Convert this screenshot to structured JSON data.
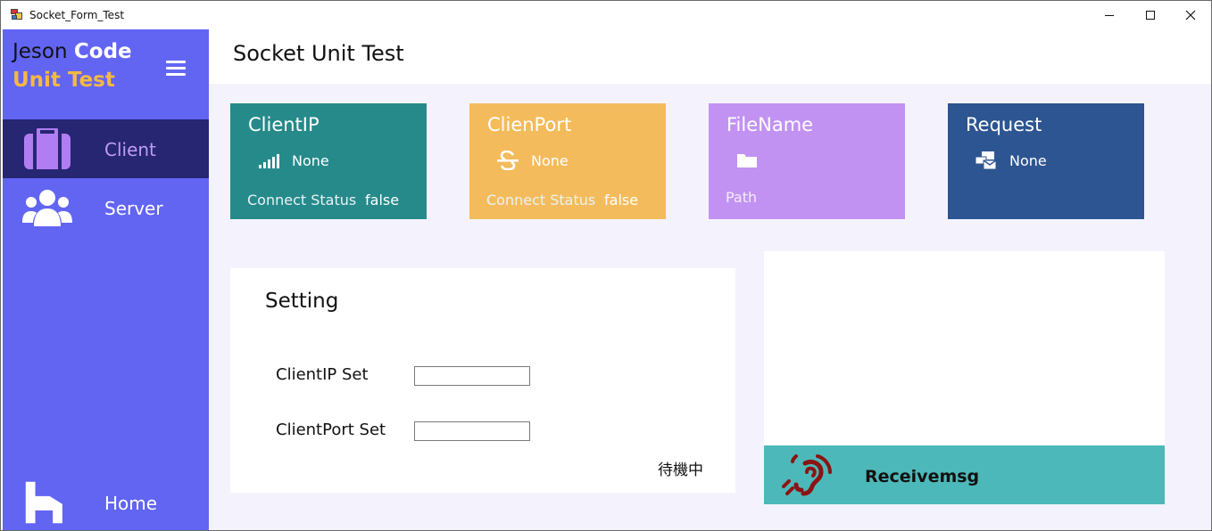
{
  "window": {
    "title": "Socket_Form_Test"
  },
  "sidebar": {
    "brand_part1": "Jeson ",
    "brand_part2": "Code",
    "brand_line2": "Unit Test",
    "items": [
      {
        "label": "Client",
        "icon": "luggage-icon",
        "active": true
      },
      {
        "label": "Server",
        "icon": "users-icon",
        "active": false
      },
      {
        "label": "Home",
        "icon": "home-icon",
        "active": false
      }
    ]
  },
  "header": {
    "title": "Socket Unit Test"
  },
  "cards": [
    {
      "title": "ClientIP",
      "icon": "signal-icon",
      "value": "None",
      "sub_label": "Connect Status",
      "sub_value": "false",
      "color": "#268a8b"
    },
    {
      "title": "ClienPort",
      "icon": "strikethrough-icon",
      "value": "None",
      "sub_label": "Connect Status",
      "sub_value": "false",
      "color": "#f4bb5c"
    },
    {
      "title": "FileName",
      "icon": "folder-icon",
      "value": "",
      "sub_label": "Path",
      "color": "#c292f3"
    },
    {
      "title": "Request",
      "icon": "mail-bulk-icon",
      "value": "None",
      "color": "#2c5591"
    }
  ],
  "setting": {
    "title": "Setting",
    "client_ip_label": "ClientIP Set",
    "client_ip_value": "",
    "client_port_label": "ClientPort Set",
    "client_port_value": "",
    "status": "待機中"
  },
  "receive": {
    "label": "Receivemsg",
    "icon": "hearing-icon",
    "bar_color": "#4db8b9"
  },
  "colors": {
    "sidebar": "#6265f2",
    "sidebar_active": "#262672",
    "brand_accent": "#f5b942",
    "active_label": "#c09bf5"
  }
}
